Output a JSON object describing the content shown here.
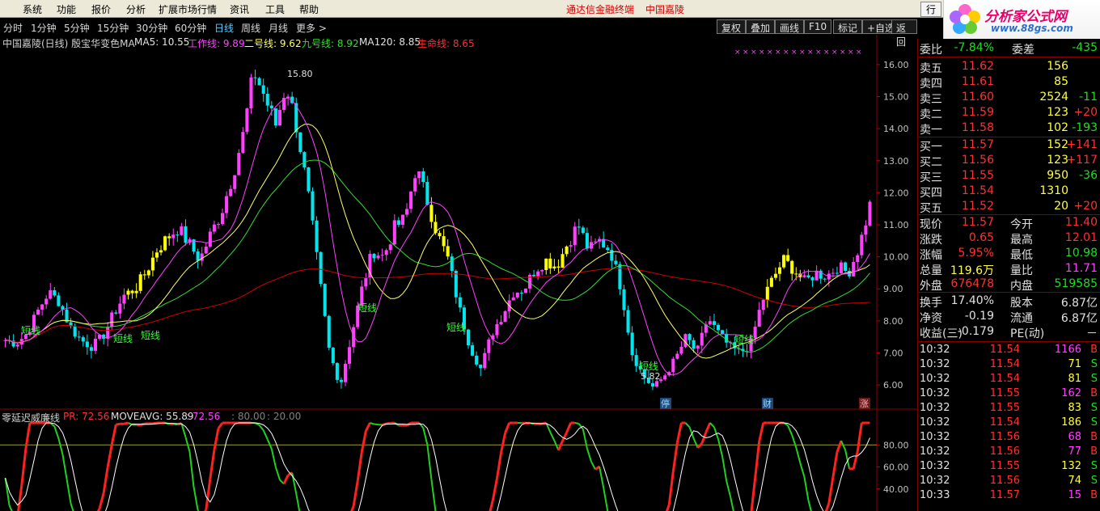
{
  "menubar": {
    "items": [
      "系统",
      "功能",
      "报价",
      "分析",
      "扩展市场行情",
      "资讯",
      "工具",
      "帮助"
    ],
    "brand": "通达信金融终端",
    "stock": "中国嘉陵",
    "hang_button": "行"
  },
  "logo": {
    "title": "分析家公式网",
    "url": "www.88gs.com"
  },
  "periods": [
    "分时",
    "1分钟",
    "5分钟",
    "15分钟",
    "30分钟",
    "60分钟",
    "日线",
    "周线",
    "月线",
    "更多 >"
  ],
  "active_period": "日线",
  "toolbar": [
    "复权",
    "叠加",
    "画线",
    "F10",
    "标记",
    "+自选",
    "返回"
  ],
  "main_info": {
    "title": "中国嘉陵(日线) 殷宝华变色MA",
    "ma5": "MA5: 10.55",
    "work": "工作线: 9.89",
    "line2": "二号线: 9.62",
    "line9": "九号线: 8.92",
    "ma120": "MA120: 8.85",
    "life": "生命线: 8.65"
  },
  "annotations": {
    "high": "15.80",
    "low": "5.82",
    "short": "短线",
    "stop": "停",
    "finance": "财",
    "rise": "涨"
  },
  "sub_info": {
    "title": "零延迟威廉线",
    "pr": "PR: 72.56",
    "moveavg": "MOVEAVG: 55.89",
    "v1": ": 72.56",
    "v2": ": 80.00",
    "v3": ": 20.00"
  },
  "chart_data": {
    "type": "candlestick",
    "y_ticks": [
      6.0,
      7.0,
      8.0,
      9.0,
      10.0,
      11.0,
      12.0,
      13.0,
      14.0,
      15.0,
      16.0
    ],
    "sub_y_ticks": [
      40.0,
      60.0,
      80.0
    ],
    "colors": {
      "up": "#ff40ff",
      "down": "#00e5ee",
      "yellow": "#ffff00",
      "ma120": "#d00000",
      "work": "#ff40ff",
      "line2": "#ffff66",
      "line9": "#33dd33"
    },
    "price_path": [
      7.4,
      7.3,
      7.6,
      8.3,
      8.9,
      8.6,
      7.8,
      7.4,
      7.2,
      7.5,
      8.2,
      8.8,
      9.0,
      9.5,
      10.2,
      10.6,
      10.9,
      10.4,
      9.9,
      10.7,
      11.4,
      12.5,
      13.8,
      15.8,
      15.0,
      14.1,
      15.4,
      14.0,
      12.0,
      9.5,
      7.0,
      6.0,
      7.5,
      9.0,
      10.2,
      10.0,
      10.9,
      11.2,
      12.8,
      11.8,
      10.7,
      9.9,
      8.4,
      7.2,
      6.5,
      7.6,
      8.2,
      8.9,
      9.0,
      9.6,
      9.9,
      9.7,
      10.4,
      11.0,
      10.2,
      10.5,
      10.2,
      9.0,
      7.0,
      6.3,
      5.9,
      6.3,
      6.8,
      7.5,
      7.0,
      8.1,
      7.6,
      7.2,
      7.0,
      7.3,
      8.6,
      9.3,
      9.9,
      9.6,
      9.2,
      9.5,
      9.4,
      9.7,
      9.5,
      10.3,
      11.6
    ]
  },
  "quote": {
    "weibi": {
      "label": "委比",
      "value": "-7.84%",
      "label2": "委差",
      "value2": "-435"
    },
    "asks": [
      {
        "label": "卖五",
        "price": "11.62",
        "vol": "156",
        "chg": ""
      },
      {
        "label": "卖四",
        "price": "11.61",
        "vol": "85",
        "chg": ""
      },
      {
        "label": "卖三",
        "price": "11.60",
        "vol": "2524",
        "chg": "-11"
      },
      {
        "label": "卖二",
        "price": "11.59",
        "vol": "123",
        "chg": "+20"
      },
      {
        "label": "卖一",
        "price": "11.58",
        "vol": "102",
        "chg": "-193"
      }
    ],
    "bids": [
      {
        "label": "买一",
        "price": "11.57",
        "vol": "152",
        "chg": "+141"
      },
      {
        "label": "买二",
        "price": "11.56",
        "vol": "123",
        "chg": "+117"
      },
      {
        "label": "买三",
        "price": "11.55",
        "vol": "950",
        "chg": "-36"
      },
      {
        "label": "买四",
        "price": "11.54",
        "vol": "1310",
        "chg": ""
      },
      {
        "label": "买五",
        "price": "11.52",
        "vol": "20",
        "chg": "+20"
      }
    ],
    "stats": [
      {
        "l1": "现价",
        "v1": "11.57",
        "l2": "今开",
        "v2": "11.40"
      },
      {
        "l1": "涨跌",
        "v1": "0.65",
        "l2": "最高",
        "v2": "12.01"
      },
      {
        "l1": "涨幅",
        "v1": "5.95%",
        "l2": "最低",
        "v2": "10.98"
      },
      {
        "l1": "总量",
        "v1": "119.6万",
        "l2": "量比",
        "v2": "11.71"
      },
      {
        "l1": "外盘",
        "v1": "676478",
        "l2": "内盘",
        "v2": "519585"
      }
    ],
    "stats2": [
      {
        "l1": "换手",
        "v1": "17.40%",
        "l2": "股本",
        "v2": "6.87亿"
      },
      {
        "l1": "净资",
        "v1": "-0.19",
        "l2": "流通",
        "v2": "6.87亿"
      },
      {
        "l1": "收益(三)",
        "v1": "-0.179",
        "l2": "PE(动)",
        "v2": "－"
      }
    ],
    "ticks": [
      {
        "t": "10:32",
        "p": "11.54",
        "v": "1166",
        "s": "B"
      },
      {
        "t": "10:32",
        "p": "11.54",
        "v": "71",
        "s": "S"
      },
      {
        "t": "10:32",
        "p": "11.54",
        "v": "81",
        "s": "S"
      },
      {
        "t": "10:32",
        "p": "11.55",
        "v": "162",
        "s": "B"
      },
      {
        "t": "10:32",
        "p": "11.55",
        "v": "83",
        "s": "S"
      },
      {
        "t": "10:32",
        "p": "11.54",
        "v": "186",
        "s": "S"
      },
      {
        "t": "10:32",
        "p": "11.56",
        "v": "68",
        "s": "B"
      },
      {
        "t": "10:32",
        "p": "11.56",
        "v": "77",
        "s": "B"
      },
      {
        "t": "10:32",
        "p": "11.55",
        "v": "132",
        "s": "S"
      },
      {
        "t": "10:32",
        "p": "11.56",
        "v": "74",
        "s": "S"
      },
      {
        "t": "10:33",
        "p": "11.57",
        "v": "15",
        "s": "B"
      }
    ]
  }
}
